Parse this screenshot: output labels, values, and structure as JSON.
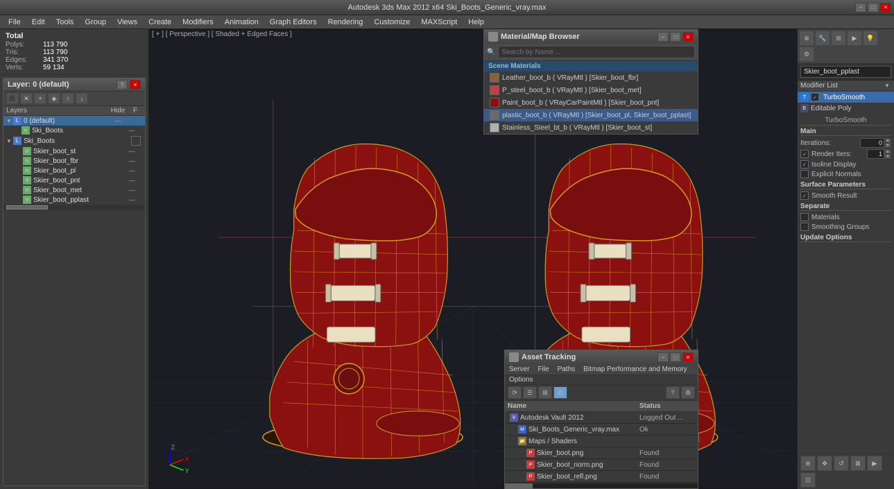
{
  "titlebar": {
    "title": "Autodesk 3ds Max 2012 x64    Ski_Boots_Generic_vray.max",
    "min": "−",
    "max": "□",
    "close": "✕"
  },
  "menubar": {
    "items": [
      "File",
      "Edit",
      "Tools",
      "Group",
      "Views",
      "Create",
      "Modifiers",
      "Animation",
      "Graph Editors",
      "Rendering",
      "Customize",
      "MAXScript",
      "Help"
    ]
  },
  "stats": {
    "total_label": "Total",
    "polys_label": "Polys:",
    "polys_val": "113 790",
    "tris_label": "Tris:",
    "tris_val": "113 790",
    "edges_label": "Edges:",
    "edges_val": "341 370",
    "verts_label": "Verts:",
    "verts_val": "59 134"
  },
  "layers": {
    "title": "Layer: 0 (default)",
    "question_btn": "?",
    "close_btn": "✕",
    "col_layers": "Layers",
    "col_hide": "Hide",
    "col_f": "F",
    "items": [
      {
        "name": "0 (default)",
        "indent": 0,
        "type": "layer",
        "selected": true,
        "hasCheckbox": false
      },
      {
        "name": "Ski_Boots",
        "indent": 1,
        "type": "object",
        "selected": false
      },
      {
        "name": "Ski_Boots",
        "indent": 1,
        "type": "layer",
        "selected": false,
        "hasCheckbox": true
      },
      {
        "name": "Skier_boot_st",
        "indent": 2,
        "type": "object"
      },
      {
        "name": "Skier_boot_fbr",
        "indent": 2,
        "type": "object"
      },
      {
        "name": "Skier_boot_pl",
        "indent": 2,
        "type": "object"
      },
      {
        "name": "Skier_boot_pnt",
        "indent": 2,
        "type": "object"
      },
      {
        "name": "Skier_boot_met",
        "indent": 2,
        "type": "object"
      },
      {
        "name": "Skier_boot_pplast",
        "indent": 2,
        "type": "object"
      }
    ]
  },
  "viewport": {
    "label": "[ + ] [ Perspective ] [ Shaded + Edged Faces ]"
  },
  "right_panel": {
    "object_name": "Skier_boot_pplast",
    "modifier_list_label": "Modifier List",
    "modifiers": [
      {
        "name": "TurboSmooth",
        "type": "turbosmooth",
        "selected": true
      },
      {
        "name": "Editable Poly",
        "type": "editpoly",
        "selected": false
      }
    ],
    "turbosmooth": {
      "section_main": "Main",
      "iterations_label": "Iterations:",
      "iterations_val": "0",
      "render_iters_label": "Render Iters:",
      "render_iters_val": "1",
      "render_iters_checked": true,
      "isoline_label": "Isoline Display",
      "isoline_checked": true,
      "explicit_label": "Explicit Normals",
      "explicit_checked": false,
      "surface_label": "Surface Parameters",
      "smooth_label": "Smooth Result",
      "smooth_checked": true,
      "separate_label": "Separate",
      "materials_label": "Materials",
      "materials_checked": false,
      "smoothing_label": "Smoothing Groups",
      "smoothing_checked": false,
      "update_label": "Update Options"
    }
  },
  "material_browser": {
    "title": "Material/Map Browser",
    "search_placeholder": "Search by Name ...",
    "section_title": "Scene Materials",
    "items": [
      {
        "name": "Leather_boot_b ( VRayMtl ) [Skier_boot_fbr]",
        "selected": false
      },
      {
        "name": "P_steel_boot_b ( VRayMtl ) [Skier_boot_met]",
        "selected": false,
        "hasSwatch": true,
        "swatchColor": "#c04040"
      },
      {
        "name": "Paint_boot_b ( VRayCarPaintMtl ) [Skier_boot_pnt]",
        "selected": false
      },
      {
        "name": "plastic_boot_b ( VRayMtl ) [Skier_boot_pl, Skier_boot_pplast]",
        "selected": true
      },
      {
        "name": "Stainless_Steel_bt_b ( VRayMtl ) [Skier_boot_st]",
        "selected": false
      }
    ]
  },
  "asset_tracking": {
    "title": "Asset Tracking",
    "menu_items": [
      "Server",
      "File",
      "Paths",
      "Bitmap Performance and Memory",
      "Options"
    ],
    "col_name": "Name",
    "col_status": "Status",
    "items": [
      {
        "name": "Autodesk Vault 2012",
        "status": "Logged Out ...",
        "indent": 0,
        "icon": "vault"
      },
      {
        "name": "Ski_Boots_Generic_vray.max",
        "status": "Ok",
        "indent": 1,
        "icon": "blue"
      },
      {
        "name": "Maps / Shaders",
        "status": "",
        "indent": 1,
        "icon": ""
      },
      {
        "name": "Skier_boot.png",
        "status": "Found",
        "indent": 2,
        "icon": "red"
      },
      {
        "name": "Skier_boot_norm.png",
        "status": "Found",
        "indent": 2,
        "icon": "red"
      },
      {
        "name": "Skier_boot_refl.png",
        "status": "Found",
        "indent": 2,
        "icon": "red"
      }
    ],
    "tracking_label": "Tracking"
  }
}
